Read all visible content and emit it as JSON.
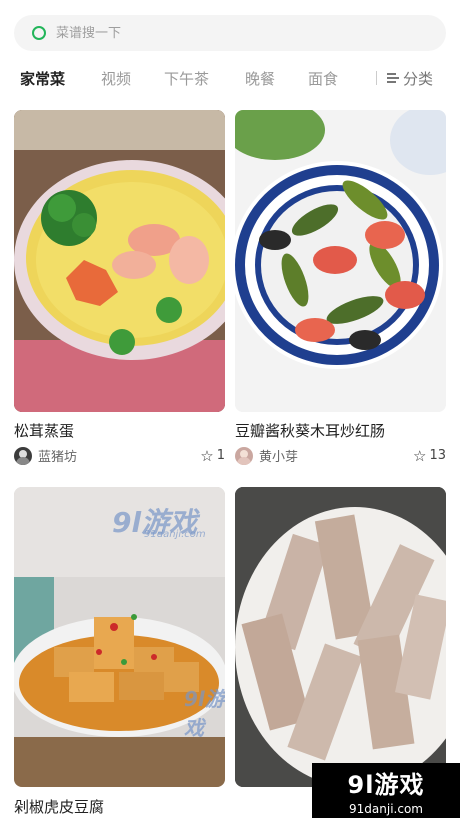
{
  "search": {
    "placeholder": "菜谱搜一下"
  },
  "tabs": [
    {
      "label": "家常菜",
      "active": true
    },
    {
      "label": "视频"
    },
    {
      "label": "下午茶"
    },
    {
      "label": "晚餐"
    },
    {
      "label": "面食"
    }
  ],
  "category_button": {
    "label": "分类"
  },
  "recipes": [
    {
      "title": "松茸蒸蛋",
      "author": "蓝猪坊",
      "stars": "1"
    },
    {
      "title": "豆瓣酱秋葵木耳炒红肠",
      "author": "黄小芽",
      "stars": "13"
    },
    {
      "title": "剁椒虎皮豆腐"
    },
    {
      "title": ""
    }
  ],
  "watermark": {
    "logo": "9l游戏",
    "url": "91danji.com",
    "overlay": "9l游戏",
    "overlay_url": "91danji.com"
  },
  "colors": {
    "accent": "#22b55a"
  }
}
